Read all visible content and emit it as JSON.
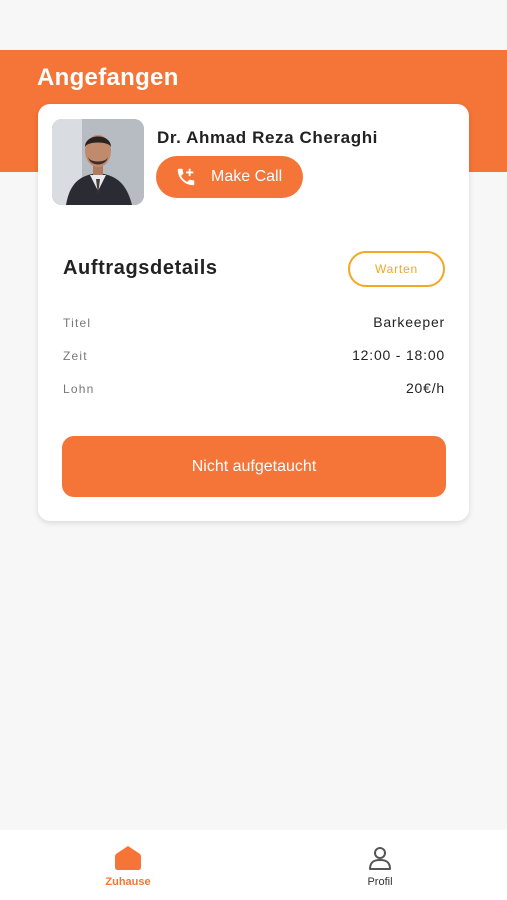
{
  "header": {
    "title": "Angefangen"
  },
  "contact": {
    "name": "Dr. Ahmad Reza Cheraghi",
    "call_button_label": "Make Call",
    "call_icon": "phone-add-icon"
  },
  "job": {
    "section_title": "Auftragsdetails",
    "status": "Warten",
    "details": [
      {
        "label": "Titel",
        "value": "Barkeeper"
      },
      {
        "label": "Zeit",
        "value": "12:00 - 18:00"
      },
      {
        "label": "Lohn",
        "value": "20€/h"
      }
    ],
    "action_label": "Nicht aufgetaucht"
  },
  "bottom_nav": {
    "items": [
      {
        "label": "Zuhause",
        "icon": "home-icon",
        "active": true
      },
      {
        "label": "Profil",
        "icon": "user-icon",
        "active": false
      }
    ]
  },
  "colors": {
    "accent": "#f57438",
    "status": "#f5a623",
    "background": "#f7f7f7"
  }
}
